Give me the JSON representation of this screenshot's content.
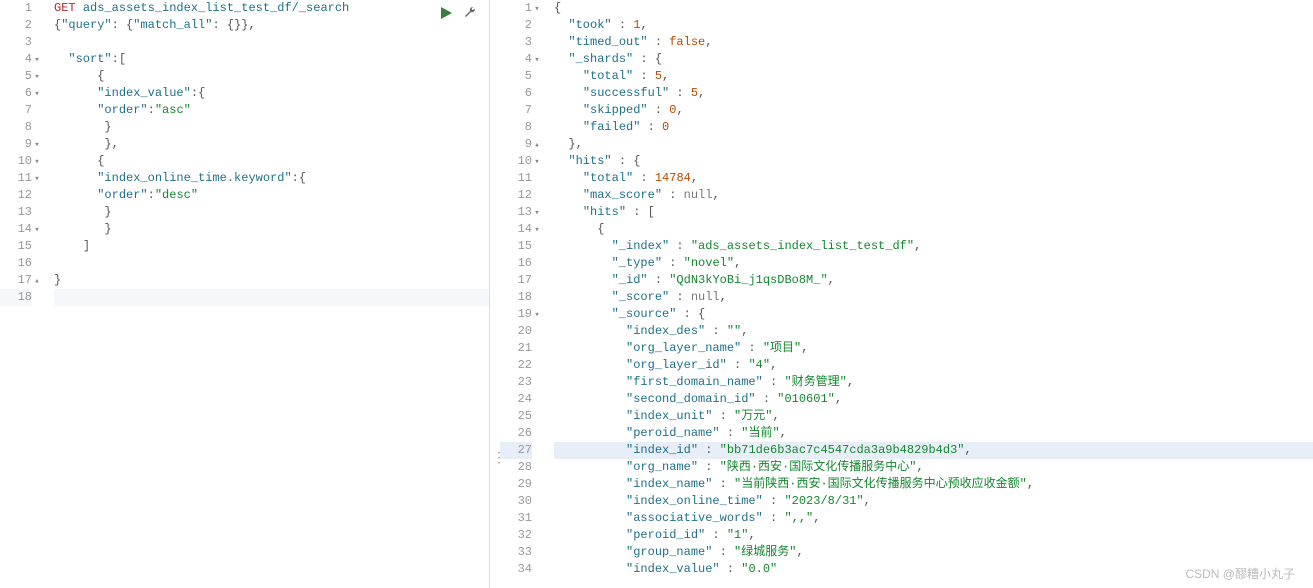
{
  "watermark": "CSDN @醪糟小丸子",
  "left": {
    "lines": [
      {
        "n": 1,
        "fold": "",
        "seg": [
          {
            "c": "method-get",
            "t": "GET"
          },
          {
            "c": "",
            "t": " "
          },
          {
            "c": "tok-key",
            "t": "ads_assets_index_list_test_df/_search"
          }
        ]
      },
      {
        "n": 2,
        "fold": "",
        "seg": [
          {
            "c": "tok-punc",
            "t": "{"
          },
          {
            "c": "tok-key",
            "t": "\"query\""
          },
          {
            "c": "tok-punc",
            "t": ": {"
          },
          {
            "c": "tok-key",
            "t": "\"match_all\""
          },
          {
            "c": "tok-punc",
            "t": ": {}},"
          }
        ]
      },
      {
        "n": 3,
        "fold": "",
        "seg": [
          {
            "c": "",
            "t": ""
          }
        ]
      },
      {
        "n": 4,
        "fold": "▾",
        "seg": [
          {
            "c": "",
            "t": "  "
          },
          {
            "c": "tok-key",
            "t": "\"sort\""
          },
          {
            "c": "tok-punc",
            "t": ":["
          }
        ]
      },
      {
        "n": 5,
        "fold": "▾",
        "seg": [
          {
            "c": "",
            "t": "      "
          },
          {
            "c": "tok-punc",
            "t": "{"
          }
        ]
      },
      {
        "n": 6,
        "fold": "▾",
        "seg": [
          {
            "c": "",
            "t": "      "
          },
          {
            "c": "tok-key",
            "t": "\"index_value\""
          },
          {
            "c": "tok-punc",
            "t": ":{"
          }
        ]
      },
      {
        "n": 7,
        "fold": "",
        "seg": [
          {
            "c": "",
            "t": "      "
          },
          {
            "c": "tok-key",
            "t": "\"order\""
          },
          {
            "c": "tok-punc",
            "t": ":"
          },
          {
            "c": "tok-str",
            "t": "\"asc\""
          }
        ]
      },
      {
        "n": 8,
        "fold": "",
        "seg": [
          {
            "c": "",
            "t": "       "
          },
          {
            "c": "tok-punc",
            "t": "}"
          }
        ]
      },
      {
        "n": 9,
        "fold": "▾",
        "seg": [
          {
            "c": "",
            "t": "       "
          },
          {
            "c": "tok-punc",
            "t": "},"
          }
        ]
      },
      {
        "n": 10,
        "fold": "▾",
        "seg": [
          {
            "c": "",
            "t": "      "
          },
          {
            "c": "tok-punc",
            "t": "{"
          }
        ]
      },
      {
        "n": 11,
        "fold": "▾",
        "seg": [
          {
            "c": "",
            "t": "      "
          },
          {
            "c": "tok-key",
            "t": "\"index_online_time.keyword\""
          },
          {
            "c": "tok-punc",
            "t": ":{"
          }
        ]
      },
      {
        "n": 12,
        "fold": "",
        "seg": [
          {
            "c": "",
            "t": "      "
          },
          {
            "c": "tok-key",
            "t": "\"order\""
          },
          {
            "c": "tok-punc",
            "t": ":"
          },
          {
            "c": "tok-str",
            "t": "\"desc\""
          }
        ]
      },
      {
        "n": 13,
        "fold": "",
        "seg": [
          {
            "c": "",
            "t": "       "
          },
          {
            "c": "tok-punc",
            "t": "}"
          }
        ]
      },
      {
        "n": 14,
        "fold": "▾",
        "seg": [
          {
            "c": "",
            "t": "       "
          },
          {
            "c": "tok-punc",
            "t": "}"
          }
        ]
      },
      {
        "n": 15,
        "fold": "",
        "seg": [
          {
            "c": "",
            "t": "    "
          },
          {
            "c": "tok-punc",
            "t": "]"
          }
        ]
      },
      {
        "n": 16,
        "fold": "",
        "seg": [
          {
            "c": "",
            "t": ""
          }
        ]
      },
      {
        "n": 17,
        "fold": "▴",
        "seg": [
          {
            "c": "tok-punc",
            "t": "}"
          }
        ]
      },
      {
        "n": 18,
        "fold": "",
        "cursor": true,
        "seg": [
          {
            "c": "",
            "t": ""
          }
        ]
      }
    ]
  },
  "right": {
    "lines": [
      {
        "n": 1,
        "fold": "▾",
        "seg": [
          {
            "c": "tok-punc",
            "t": "{"
          }
        ]
      },
      {
        "n": 2,
        "fold": "",
        "seg": [
          {
            "c": "",
            "t": "  "
          },
          {
            "c": "tok-key",
            "t": "\"took\""
          },
          {
            "c": "tok-punc",
            "t": " : "
          },
          {
            "c": "tok-num",
            "t": "1"
          },
          {
            "c": "tok-punc",
            "t": ","
          }
        ]
      },
      {
        "n": 3,
        "fold": "",
        "seg": [
          {
            "c": "",
            "t": "  "
          },
          {
            "c": "tok-key",
            "t": "\"timed_out\""
          },
          {
            "c": "tok-punc",
            "t": " : "
          },
          {
            "c": "tok-bool",
            "t": "false"
          },
          {
            "c": "tok-punc",
            "t": ","
          }
        ]
      },
      {
        "n": 4,
        "fold": "▾",
        "seg": [
          {
            "c": "",
            "t": "  "
          },
          {
            "c": "tok-key",
            "t": "\"_shards\""
          },
          {
            "c": "tok-punc",
            "t": " : {"
          }
        ]
      },
      {
        "n": 5,
        "fold": "",
        "seg": [
          {
            "c": "",
            "t": "    "
          },
          {
            "c": "tok-key",
            "t": "\"total\""
          },
          {
            "c": "tok-punc",
            "t": " : "
          },
          {
            "c": "tok-num",
            "t": "5"
          },
          {
            "c": "tok-punc",
            "t": ","
          }
        ]
      },
      {
        "n": 6,
        "fold": "",
        "seg": [
          {
            "c": "",
            "t": "    "
          },
          {
            "c": "tok-key",
            "t": "\"successful\""
          },
          {
            "c": "tok-punc",
            "t": " : "
          },
          {
            "c": "tok-num",
            "t": "5"
          },
          {
            "c": "tok-punc",
            "t": ","
          }
        ]
      },
      {
        "n": 7,
        "fold": "",
        "seg": [
          {
            "c": "",
            "t": "    "
          },
          {
            "c": "tok-key",
            "t": "\"skipped\""
          },
          {
            "c": "tok-punc",
            "t": " : "
          },
          {
            "c": "tok-num",
            "t": "0"
          },
          {
            "c": "tok-punc",
            "t": ","
          }
        ]
      },
      {
        "n": 8,
        "fold": "",
        "seg": [
          {
            "c": "",
            "t": "    "
          },
          {
            "c": "tok-key",
            "t": "\"failed\""
          },
          {
            "c": "tok-punc",
            "t": " : "
          },
          {
            "c": "tok-num",
            "t": "0"
          }
        ]
      },
      {
        "n": 9,
        "fold": "▴",
        "seg": [
          {
            "c": "",
            "t": "  "
          },
          {
            "c": "tok-punc",
            "t": "},"
          }
        ]
      },
      {
        "n": 10,
        "fold": "▾",
        "seg": [
          {
            "c": "",
            "t": "  "
          },
          {
            "c": "tok-key",
            "t": "\"hits\""
          },
          {
            "c": "tok-punc",
            "t": " : {"
          }
        ]
      },
      {
        "n": 11,
        "fold": "",
        "seg": [
          {
            "c": "",
            "t": "    "
          },
          {
            "c": "tok-key",
            "t": "\"total\""
          },
          {
            "c": "tok-punc",
            "t": " : "
          },
          {
            "c": "tok-num",
            "t": "14784"
          },
          {
            "c": "tok-punc",
            "t": ","
          }
        ]
      },
      {
        "n": 12,
        "fold": "",
        "seg": [
          {
            "c": "",
            "t": "    "
          },
          {
            "c": "tok-key",
            "t": "\"max_score\""
          },
          {
            "c": "tok-punc",
            "t": " : "
          },
          {
            "c": "tok-null",
            "t": "null"
          },
          {
            "c": "tok-punc",
            "t": ","
          }
        ]
      },
      {
        "n": 13,
        "fold": "▾",
        "seg": [
          {
            "c": "",
            "t": "    "
          },
          {
            "c": "tok-key",
            "t": "\"hits\""
          },
          {
            "c": "tok-punc",
            "t": " : ["
          }
        ]
      },
      {
        "n": 14,
        "fold": "▾",
        "seg": [
          {
            "c": "",
            "t": "      "
          },
          {
            "c": "tok-punc",
            "t": "{"
          }
        ]
      },
      {
        "n": 15,
        "fold": "",
        "seg": [
          {
            "c": "",
            "t": "        "
          },
          {
            "c": "tok-key",
            "t": "\"_index\""
          },
          {
            "c": "tok-punc",
            "t": " : "
          },
          {
            "c": "tok-str",
            "t": "\"ads_assets_index_list_test_df\""
          },
          {
            "c": "tok-punc",
            "t": ","
          }
        ]
      },
      {
        "n": 16,
        "fold": "",
        "seg": [
          {
            "c": "",
            "t": "        "
          },
          {
            "c": "tok-key",
            "t": "\"_type\""
          },
          {
            "c": "tok-punc",
            "t": " : "
          },
          {
            "c": "tok-str",
            "t": "\"novel\""
          },
          {
            "c": "tok-punc",
            "t": ","
          }
        ]
      },
      {
        "n": 17,
        "fold": "",
        "seg": [
          {
            "c": "",
            "t": "        "
          },
          {
            "c": "tok-key",
            "t": "\"_id\""
          },
          {
            "c": "tok-punc",
            "t": " : "
          },
          {
            "c": "tok-str",
            "t": "\"QdN3kYoBi_j1qsDBo8M_\""
          },
          {
            "c": "tok-punc",
            "t": ","
          }
        ]
      },
      {
        "n": 18,
        "fold": "",
        "seg": [
          {
            "c": "",
            "t": "        "
          },
          {
            "c": "tok-key",
            "t": "\"_score\""
          },
          {
            "c": "tok-punc",
            "t": " : "
          },
          {
            "c": "tok-null",
            "t": "null"
          },
          {
            "c": "tok-punc",
            "t": ","
          }
        ]
      },
      {
        "n": 19,
        "fold": "▾",
        "seg": [
          {
            "c": "",
            "t": "        "
          },
          {
            "c": "tok-key",
            "t": "\"_source\""
          },
          {
            "c": "tok-punc",
            "t": " : {"
          }
        ]
      },
      {
        "n": 20,
        "fold": "",
        "seg": [
          {
            "c": "",
            "t": "          "
          },
          {
            "c": "tok-key",
            "t": "\"index_des\""
          },
          {
            "c": "tok-punc",
            "t": " : "
          },
          {
            "c": "tok-str",
            "t": "\"\""
          },
          {
            "c": "tok-punc",
            "t": ","
          }
        ]
      },
      {
        "n": 21,
        "fold": "",
        "seg": [
          {
            "c": "",
            "t": "          "
          },
          {
            "c": "tok-key",
            "t": "\"org_layer_name\""
          },
          {
            "c": "tok-punc",
            "t": " : "
          },
          {
            "c": "tok-str",
            "t": "\"项目\""
          },
          {
            "c": "tok-punc",
            "t": ","
          }
        ]
      },
      {
        "n": 22,
        "fold": "",
        "seg": [
          {
            "c": "",
            "t": "          "
          },
          {
            "c": "tok-key",
            "t": "\"org_layer_id\""
          },
          {
            "c": "tok-punc",
            "t": " : "
          },
          {
            "c": "tok-str",
            "t": "\"4\""
          },
          {
            "c": "tok-punc",
            "t": ","
          }
        ]
      },
      {
        "n": 23,
        "fold": "",
        "seg": [
          {
            "c": "",
            "t": "          "
          },
          {
            "c": "tok-key",
            "t": "\"first_domain_name\""
          },
          {
            "c": "tok-punc",
            "t": " : "
          },
          {
            "c": "tok-str",
            "t": "\"财务管理\""
          },
          {
            "c": "tok-punc",
            "t": ","
          }
        ]
      },
      {
        "n": 24,
        "fold": "",
        "seg": [
          {
            "c": "",
            "t": "          "
          },
          {
            "c": "tok-key",
            "t": "\"second_domain_id\""
          },
          {
            "c": "tok-punc",
            "t": " : "
          },
          {
            "c": "tok-str",
            "t": "\"010601\""
          },
          {
            "c": "tok-punc",
            "t": ","
          }
        ]
      },
      {
        "n": 25,
        "fold": "",
        "seg": [
          {
            "c": "",
            "t": "          "
          },
          {
            "c": "tok-key",
            "t": "\"index_unit\""
          },
          {
            "c": "tok-punc",
            "t": " : "
          },
          {
            "c": "tok-str",
            "t": "\"万元\""
          },
          {
            "c": "tok-punc",
            "t": ","
          }
        ]
      },
      {
        "n": 26,
        "fold": "",
        "seg": [
          {
            "c": "",
            "t": "          "
          },
          {
            "c": "tok-key",
            "t": "\"peroid_name\""
          },
          {
            "c": "tok-punc",
            "t": " : "
          },
          {
            "c": "tok-str",
            "t": "\"当前\""
          },
          {
            "c": "tok-punc",
            "t": ","
          }
        ]
      },
      {
        "n": 27,
        "fold": "",
        "hl": true,
        "seg": [
          {
            "c": "",
            "t": "          "
          },
          {
            "c": "tok-key",
            "t": "\"index_id\""
          },
          {
            "c": "tok-punc",
            "t": " : "
          },
          {
            "c": "tok-str",
            "t": "\"bb71de6b3ac7c4547cda3a9b4829b4d3\""
          },
          {
            "c": "tok-punc",
            "t": ","
          }
        ]
      },
      {
        "n": 28,
        "fold": "",
        "seg": [
          {
            "c": "",
            "t": "          "
          },
          {
            "c": "tok-key",
            "t": "\"org_name\""
          },
          {
            "c": "tok-punc",
            "t": " : "
          },
          {
            "c": "tok-str",
            "t": "\"陕西·西安·国际文化传播服务中心\""
          },
          {
            "c": "tok-punc",
            "t": ","
          }
        ]
      },
      {
        "n": 29,
        "fold": "",
        "seg": [
          {
            "c": "",
            "t": "          "
          },
          {
            "c": "tok-key",
            "t": "\"index_name\""
          },
          {
            "c": "tok-punc",
            "t": " : "
          },
          {
            "c": "tok-str",
            "t": "\"当前陕西·西安·国际文化传播服务中心预收应收金额\""
          },
          {
            "c": "tok-punc",
            "t": ","
          }
        ]
      },
      {
        "n": 30,
        "fold": "",
        "seg": [
          {
            "c": "",
            "t": "          "
          },
          {
            "c": "tok-key",
            "t": "\"index_online_time\""
          },
          {
            "c": "tok-punc",
            "t": " : "
          },
          {
            "c": "tok-str",
            "t": "\"2023/8/31\""
          },
          {
            "c": "tok-punc",
            "t": ","
          }
        ]
      },
      {
        "n": 31,
        "fold": "",
        "seg": [
          {
            "c": "",
            "t": "          "
          },
          {
            "c": "tok-key",
            "t": "\"associative_words\""
          },
          {
            "c": "tok-punc",
            "t": " : "
          },
          {
            "c": "tok-str",
            "t": "\",,\""
          },
          {
            "c": "tok-punc",
            "t": ","
          }
        ]
      },
      {
        "n": 32,
        "fold": "",
        "seg": [
          {
            "c": "",
            "t": "          "
          },
          {
            "c": "tok-key",
            "t": "\"peroid_id\""
          },
          {
            "c": "tok-punc",
            "t": " : "
          },
          {
            "c": "tok-str",
            "t": "\"1\""
          },
          {
            "c": "tok-punc",
            "t": ","
          }
        ]
      },
      {
        "n": 33,
        "fold": "",
        "seg": [
          {
            "c": "",
            "t": "          "
          },
          {
            "c": "tok-key",
            "t": "\"group_name\""
          },
          {
            "c": "tok-punc",
            "t": " : "
          },
          {
            "c": "tok-str",
            "t": "\"绿城服务\""
          },
          {
            "c": "tok-punc",
            "t": ","
          }
        ]
      },
      {
        "n": 34,
        "fold": "",
        "seg": [
          {
            "c": "",
            "t": "          "
          },
          {
            "c": "tok-key",
            "t": "\"index_value\""
          },
          {
            "c": "tok-punc",
            "t": " : "
          },
          {
            "c": "tok-str",
            "t": "\"0.0\""
          }
        ]
      }
    ]
  }
}
